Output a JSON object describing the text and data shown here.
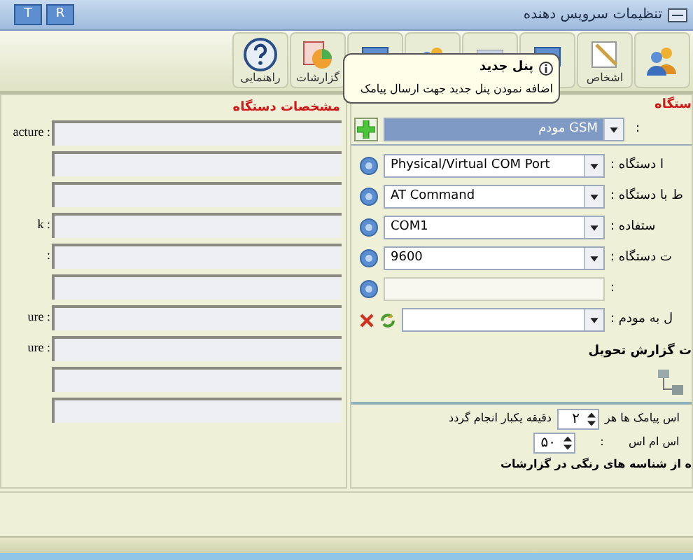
{
  "window": {
    "title": "تنظیمات سرویس دهنده",
    "title_buttons": [
      "R",
      "T"
    ]
  },
  "toolbar": [
    {
      "kind": "users"
    },
    {
      "label": "اشخاص",
      "kind": "note"
    },
    {
      "kind": "monitor"
    },
    {
      "kind": "calendar"
    },
    {
      "kind": "users"
    },
    {
      "kind": "monitor"
    },
    {
      "label": "گزارشات",
      "kind": "report"
    },
    {
      "label": "راهنمایی",
      "kind": "help"
    }
  ],
  "tooltip": {
    "title": "پنل جدید",
    "text": "اضافه نمودن پنل جدید جهت ارسال پیامک"
  },
  "device_specs": {
    "title": "مشخصات دستگاه",
    "fields": [
      {
        "kind": "text",
        "label": "acture :"
      },
      {
        "kind": "text"
      },
      {
        "kind": "text"
      },
      {
        "kind": "text",
        "label": "k :"
      },
      {
        "kind": "text",
        "label": ":"
      },
      {
        "kind": "text"
      },
      {
        "kind": "text",
        "label": "ure :"
      },
      {
        "kind": "text",
        "label": "ure :"
      },
      {
        "kind": "text"
      },
      {
        "kind": "text"
      }
    ]
  },
  "device": {
    "title": "ستگاه",
    "panel_select": {
      "value": "مودم GSM",
      "label": ":"
    },
    "rows": [
      {
        "kind": "select",
        "value": "Physical/Virtual COM Port",
        "label": ":  ا دستگاه"
      },
      {
        "kind": "select",
        "value": "AT Command",
        "label": ":  ط با دستگاه"
      },
      {
        "kind": "select",
        "value": "COM1",
        "label": ":  ستفاده"
      },
      {
        "kind": "select",
        "value": "9600",
        "label": ":  ت دستگاه"
      },
      {
        "kind": "text",
        "label": ":"
      },
      {
        "kind": "modem",
        "label": ":  ل به مودم"
      }
    ],
    "delivery_title": "ت گزارش تحویل",
    "check_label": "اس پیامک ها هر",
    "check_value": "۲",
    "check_suffix": "دقیقه یکبار انجام گردد",
    "sms_label": "اس ام اس",
    "sms_colon": ":",
    "sms_value": "۵۰",
    "color_note": "ه از شناسه های رنگی در گزارشات"
  }
}
